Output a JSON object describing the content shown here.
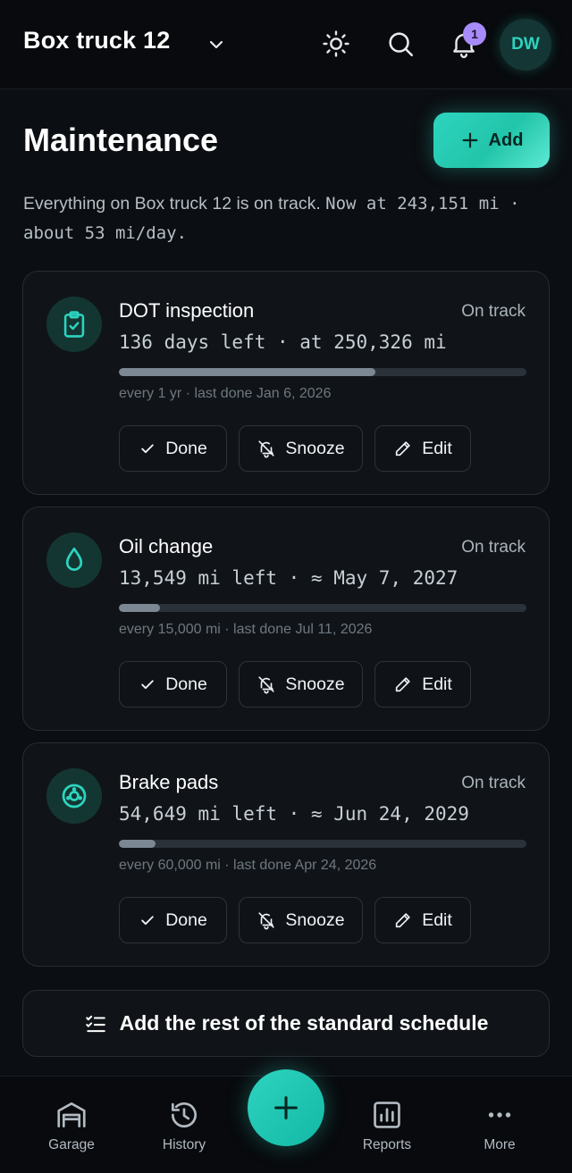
{
  "header": {
    "vehicle": "Box truck 12",
    "notification_count": "1",
    "avatar_initials": "DW"
  },
  "page": {
    "title": "Maintenance",
    "add_label": "Add",
    "summary_text": "Everything on Box truck 12 is on track.",
    "summary_odometer": "Now at 243,151 mi · about 53 mi/day."
  },
  "items": [
    {
      "icon": "clipboard-check-icon",
      "name": "DOT inspection",
      "status": "On track",
      "remaining": "136 days left · at 250,326 mi",
      "progress": 0.63,
      "meta": "every 1 yr · last done Jan 6, 2026"
    },
    {
      "icon": "droplet-icon",
      "name": "Oil change",
      "status": "On track",
      "remaining": "13,549 mi left · ≈ May 7, 2027",
      "progress": 0.1,
      "meta": "every 15,000 mi · last done Jul 11, 2026"
    },
    {
      "icon": "brake-disc-icon",
      "name": "Brake pads",
      "status": "On track",
      "remaining": "54,649 mi left · ≈ Jun 24, 2029",
      "progress": 0.09,
      "meta": "every 60,000 mi · last done Apr 24, 2026"
    }
  ],
  "actions": {
    "done": "Done",
    "snooze": "Snooze",
    "edit": "Edit"
  },
  "schedule_button": "Add the rest of the standard schedule",
  "nav": {
    "garage": "Garage",
    "history": "History",
    "reports": "Reports",
    "more": "More"
  },
  "colors": {
    "accent": "#2dd4bf",
    "background": "#0b0e12",
    "card": "#101418",
    "badge": "#a78bfa"
  }
}
